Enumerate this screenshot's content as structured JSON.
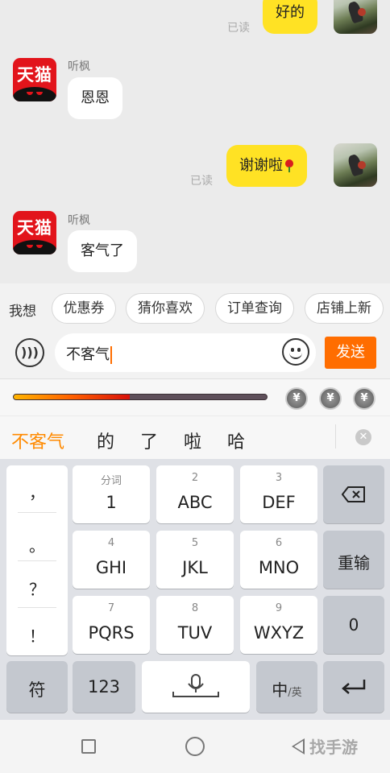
{
  "chat": {
    "messages": [
      {
        "side": "right",
        "text": "好的",
        "read": "已读"
      },
      {
        "side": "left",
        "sender": "听枫",
        "text": "恩恩",
        "avatar_text": "天猫"
      },
      {
        "side": "right",
        "text": "谢谢啦",
        "read": "已读",
        "emoji": "rose"
      },
      {
        "side": "left",
        "sender": "听枫",
        "text": "客气了",
        "avatar_text": "天猫"
      }
    ]
  },
  "quick_replies": {
    "label": "我想",
    "chips": [
      "优惠券",
      "猜你喜欢",
      "订单查询",
      "店铺上新"
    ]
  },
  "input": {
    "value": "不客气",
    "send_label": "发送"
  },
  "keyboard_top": {
    "progress": 0.46,
    "coins": [
      "¥",
      "¥",
      "¥"
    ]
  },
  "candidates": [
    "不客气",
    "的",
    "了",
    "啦",
    "哈"
  ],
  "keyboard": {
    "punct": [
      "，",
      "。",
      "？",
      "！"
    ],
    "keys": [
      {
        "sub": "分词",
        "main": "1"
      },
      {
        "sub": "2",
        "main": "ABC"
      },
      {
        "sub": "3",
        "main": "DEF"
      },
      {
        "sub": "4",
        "main": "GHI"
      },
      {
        "sub": "5",
        "main": "JKL"
      },
      {
        "sub": "6",
        "main": "MNO"
      },
      {
        "sub": "7",
        "main": "PQRS"
      },
      {
        "sub": "8",
        "main": "TUV"
      },
      {
        "sub": "9",
        "main": "WXYZ"
      }
    ],
    "reinput": "重输",
    "zero": "0",
    "symbol": "符",
    "num": "123",
    "lang_main": "中",
    "lang_sub": "/英"
  },
  "watermark": "找手游",
  "colors": {
    "accent": "#ff6d00",
    "bubble_self": "#ffe224",
    "brand": "#e2141b"
  }
}
